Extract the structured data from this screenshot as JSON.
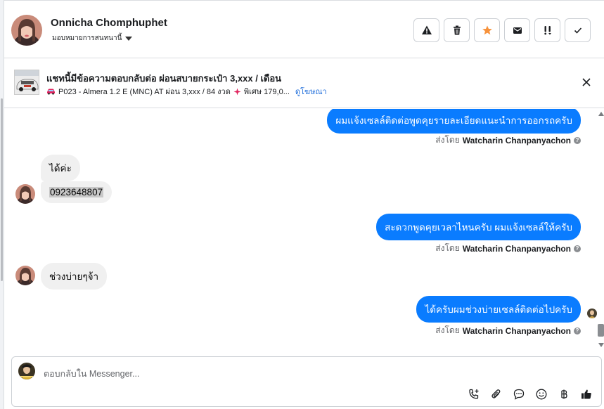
{
  "header": {
    "contact_name": "Onnicha Chomphuphet",
    "assign_label": "มอบหมายการสนทนานี้",
    "actions": [
      {
        "name": "mark-spam-button",
        "icon": "warning-icon"
      },
      {
        "name": "delete-button",
        "icon": "trash-icon"
      },
      {
        "name": "star-button",
        "icon": "star-icon"
      },
      {
        "name": "mark-unread-button",
        "icon": "envelope-icon"
      },
      {
        "name": "follow-up-button",
        "icon": "exclamation-icon"
      },
      {
        "name": "mark-done-button",
        "icon": "check-icon"
      }
    ]
  },
  "ad": {
    "title": "แชทนี้มีข้อความตอบกลับต่อ ผ่อนสบายกระเป๋า 3,xxx / เดือน",
    "subtitle": "P023 - Almera 1.2 E (MNC) AT ผ่อน 3,xxx / 84 งวด",
    "subtitle_tail": "พิเศษ 179,0...",
    "link": "ดูโฆษณา"
  },
  "messages": {
    "out1": "ผมแจ้งเซลล์ติดต่อพูดคุยรายละเอียดแนะนำการออกรถครับ",
    "in1": "ได้ค่ะ",
    "in2": "0923648807",
    "out2": "สะดวกพูดคุยเวลาไหนครับ ผมแจ้งเซลล์ให้ครับ",
    "in3": "ช่วงบ่ายๆจ้า",
    "out3": "ได้ครับผมช่วงบ่ายเซลล์ติดต่อไปครับ",
    "sent_by_prefix": "ส่งโดย",
    "sent_by_name": "Watcharin Chanpanyachon"
  },
  "composer": {
    "placeholder": "ตอบกลับใน Messenger..."
  },
  "colors": {
    "outgoing_bubble": "#0a7cff",
    "incoming_bubble": "#f0f0f0",
    "star": "#f7923b",
    "link": "#216fdb"
  }
}
